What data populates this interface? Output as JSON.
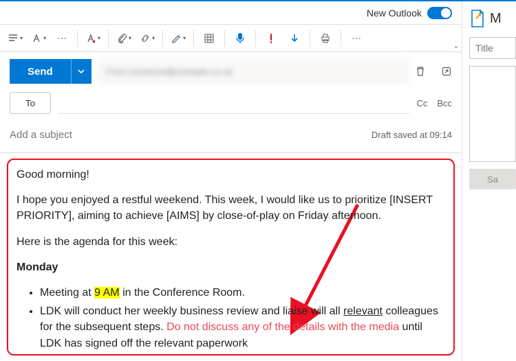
{
  "header": {
    "new_outlook_label": "New Outlook"
  },
  "toolbar": {
    "send_label": "Send",
    "from_placeholder": "From  someone@example.co.uk"
  },
  "recipients": {
    "to_button": "To",
    "cc": "Cc",
    "bcc": "Bcc"
  },
  "subject": {
    "placeholder": "Add a subject",
    "draft_saved": "Draft saved at 09:14"
  },
  "body": {
    "greeting": "Good morning!",
    "intro": "I hope you enjoyed a restful weekend. This week, I would like us to prioritize [INSERT PRIORITY], aiming to achieve [AIMS] by close-of-play on Friday afternoon.",
    "agenda_lead": "Here is the agenda for this week:",
    "day_heading": "Monday",
    "bullet1_pre": "Meeting at ",
    "bullet1_hl": "9 AM",
    "bullet1_post": " in the Conference Room.",
    "bullet2_a": "LDK will conduct her weekly business review and liaise will all ",
    "bullet2_b": "relevant",
    "bullet2_c": " colleagues for the subsequent steps. ",
    "bullet2_d": "Do not discuss any of the details with the media",
    "bullet2_e": " until LDK has signed off the relevant paperwork"
  },
  "right_pane": {
    "header_initial": "M",
    "title_placeholder": "Title",
    "save_label": "Sa"
  }
}
